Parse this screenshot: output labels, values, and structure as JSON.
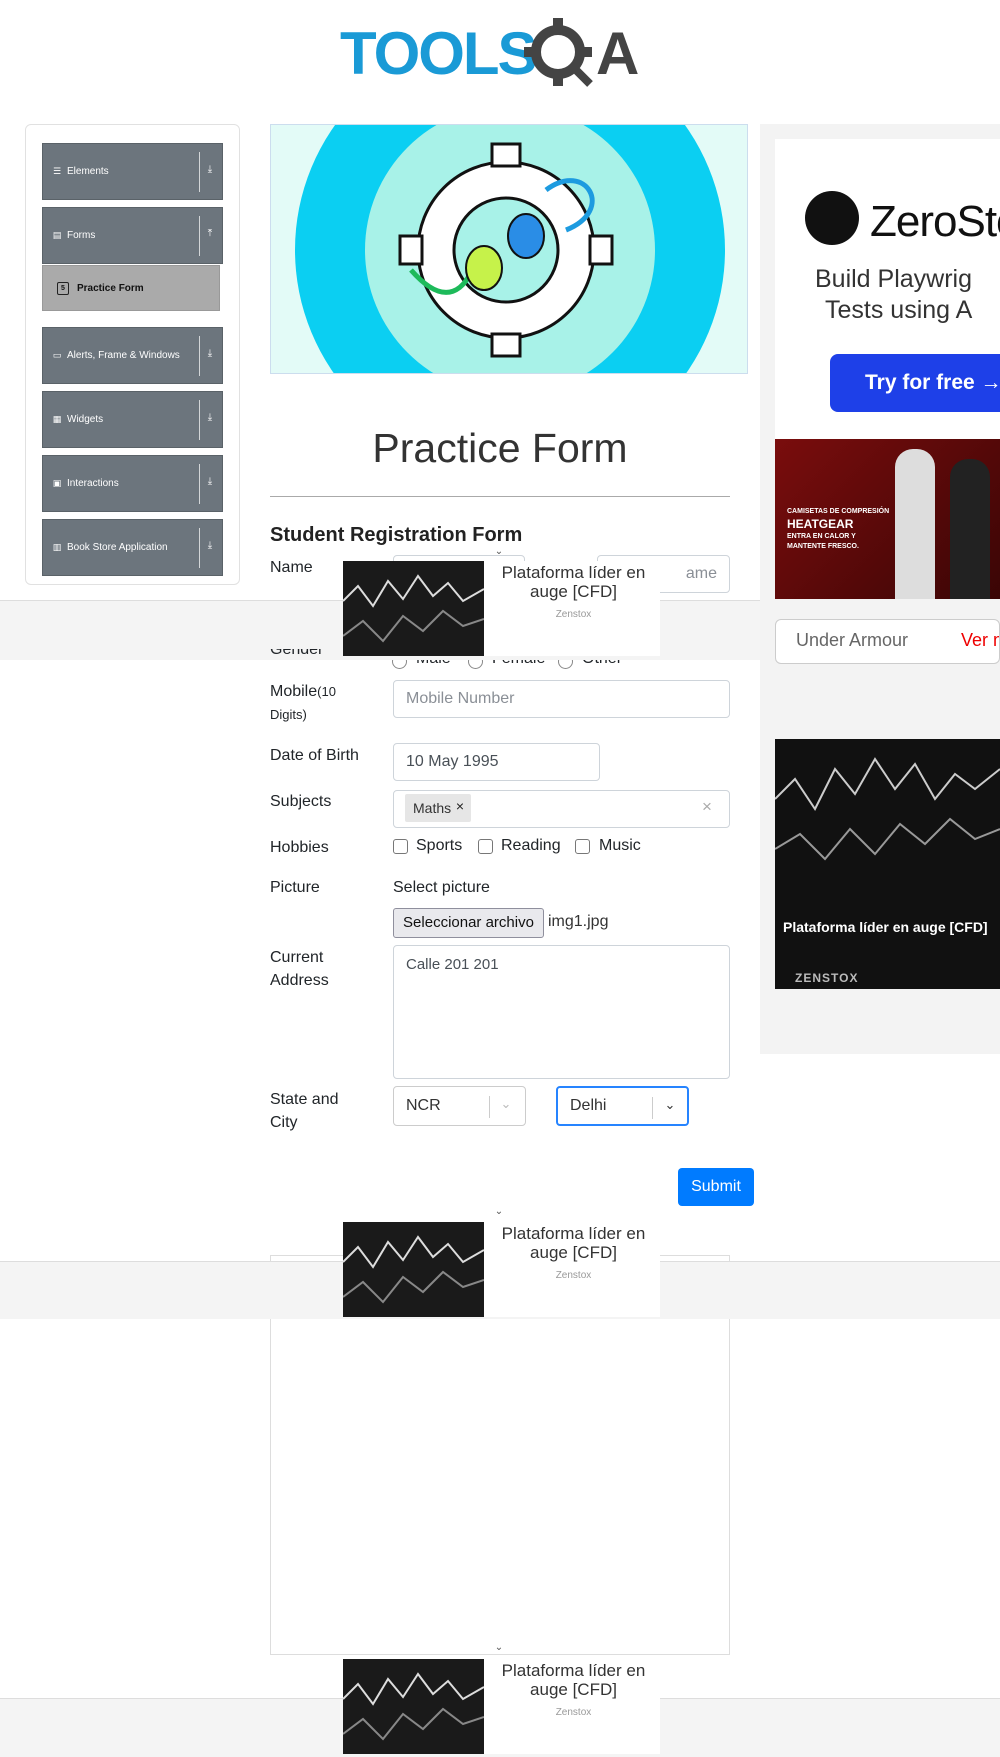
{
  "header": {
    "logo_text": "TOOLSQA",
    "logo_icon": "gear-search-icon"
  },
  "sidebar": {
    "groups": [
      {
        "label": "Elements",
        "icon": "menu-icon"
      },
      {
        "label": "Forms",
        "icon": "form-icon"
      },
      {
        "label": "Alerts, Frame & Windows",
        "icon": "window-icon"
      },
      {
        "label": "Widgets",
        "icon": "grid-icon"
      },
      {
        "label": "Interactions",
        "icon": "interaction-icon"
      },
      {
        "label": "Book Store Application",
        "icon": "book-icon"
      }
    ],
    "active_item": "Practice Form"
  },
  "page": {
    "title": "Practice Form",
    "form_heading": "Student Registration Form"
  },
  "form": {
    "name_label": "Name",
    "last_name_placeholder": "ame",
    "gender_label": "Gender",
    "gender_options": [
      "Male",
      "Female",
      "Other"
    ],
    "mobile_label": "Mobile",
    "mobile_hint": "(10",
    "mobile_hint2": "Digits)",
    "mobile_placeholder": "Mobile Number",
    "dob_label": "Date of Birth",
    "dob_value": "10 May 1995",
    "subjects_label": "Subjects",
    "subjects": [
      "Maths"
    ],
    "hobbies_label": "Hobbies",
    "hobbies": [
      "Sports",
      "Reading",
      "Music"
    ],
    "picture_label": "Picture",
    "select_picture": "Select picture",
    "file_button": "Seleccionar archivo",
    "file_name": "img1.jpg",
    "address_label_1": "Current",
    "address_label_2": "Address",
    "address_value": "Calle 201 201",
    "state_label_1": "State and",
    "state_label_2": "City",
    "state_value": "NCR",
    "city_value": "Delhi",
    "submit_label": "Submit"
  },
  "ads": {
    "popup_title": "Plataforma líder en auge [CFD]",
    "popup_brand": "Zenstox",
    "zerostox_name": "ZeroSto",
    "zerostox_text_1": "Build Playwrig",
    "zerostox_text_2": "Tests using A",
    "zerostox_button": "Try for free →",
    "ua_caption": "Under Armour",
    "ua_more": "Ver m",
    "ua_promo_1": "CAMISETAS DE COMPRESIÓN",
    "ua_promo_2": "HEATGEAR",
    "ua_promo_3": "ENTRA EN CALOR Y",
    "ua_promo_4": "MANTENTE FRESCO.",
    "zen_card_title": "Plataforma líder en auge [CFD]",
    "zen_card_brand": "ZENSTOX"
  },
  "colors": {
    "accent": "#007bff",
    "sidebar": "#6c757d",
    "logo_blue": "#1a9ad6"
  }
}
